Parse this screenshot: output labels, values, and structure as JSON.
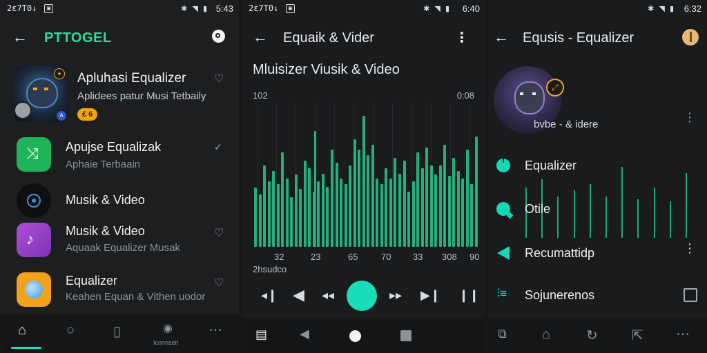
{
  "accent": "#19dcb9",
  "bar_color": "#23b07c",
  "panel1": {
    "status": {
      "time": "2ɛ7T0↓",
      "clock": "5:43"
    },
    "header": {
      "title": "PTTOGEL",
      "title_color": "#2fdc9a"
    },
    "featured": {
      "title": "Apluhasi Equalizer",
      "subtitle": "Aplidees patur Musi Tetbaily",
      "badge": "₤ 6"
    },
    "items": [
      {
        "title": "Apujse Equalizak",
        "subtitle": "Aphaie Terbaain",
        "icon": "wand-icon",
        "color": "#1fb45a"
      },
      {
        "title": "Musik & Video",
        "subtitle": "",
        "icon": "disc-icon",
        "color": "#0e0f10"
      },
      {
        "title": "Musik & Video",
        "subtitle": "Aquaak Equalizer Musak",
        "icon": "music-note-icon",
        "color": "#9e3fc9"
      },
      {
        "title": "Equalizer",
        "subtitle": "Keahen Equan & Vithen uodor",
        "icon": "orb-icon",
        "color": "#f4a11c"
      }
    ],
    "nav": [
      {
        "label": "",
        "icon": "home-icon"
      },
      {
        "label": "",
        "icon": "search-icon"
      },
      {
        "label": "",
        "icon": "library-icon"
      },
      {
        "label": "Iconnseit",
        "icon": "profile-icon"
      },
      {
        "label": "",
        "icon": "more-icon"
      }
    ]
  },
  "panel2": {
    "status": {
      "time": "2ɛ7T0↓",
      "clock": "6:40"
    },
    "header": {
      "title": "Equaik & Vider"
    },
    "subtitle": "Mluisizer Viusik & Video",
    "left_value": "102",
    "right_value": "0:08",
    "ticks": [
      "32",
      "23",
      "65",
      "70",
      "33",
      "308",
      "90"
    ],
    "footer_label": "2hsudco",
    "spectrum_levels": [
      0.45,
      0.4,
      0.62,
      0.5,
      0.58,
      0.48,
      0.72,
      0.52,
      0.38,
      0.55,
      0.44,
      0.66,
      0.6,
      0.42,
      0.5,
      0.56,
      0.46,
      0.74,
      0.64,
      0.52,
      0.48,
      0.62,
      0.82,
      0.74,
      1.0,
      0.7,
      0.78,
      0.52,
      0.48,
      0.6,
      0.52,
      0.68,
      0.56,
      0.66,
      0.42,
      0.5,
      0.72,
      0.6,
      0.76,
      0.62,
      0.55,
      0.62,
      0.78,
      0.54,
      0.68,
      0.58,
      0.52,
      0.74,
      0.48,
      0.84
    ],
    "nav": [
      {
        "icon": "recents-icon"
      },
      {
        "icon": "back-triangle-icon"
      },
      {
        "icon": "home-circle-icon"
      },
      {
        "icon": "square-icon"
      }
    ]
  },
  "panel3": {
    "status": {
      "clock": "6:32"
    },
    "header": {
      "title": "Equsis - Equalizer"
    },
    "avatar_caption": "bvbe - & idere",
    "menu": [
      {
        "label": "Equalizer",
        "icon": "power-icon"
      },
      {
        "label": "Otile",
        "icon": "chat-bubble-icon"
      },
      {
        "label": "Recumattidp",
        "icon": "speaker-icon"
      },
      {
        "label": "Sojunerenos",
        "icon": "sliders-icon"
      }
    ],
    "line_levels": [
      0.58,
      0.68,
      0.48,
      0.55,
      0.62,
      0.48,
      0.82,
      0.45,
      0.58,
      0.42,
      0.75
    ]
  }
}
